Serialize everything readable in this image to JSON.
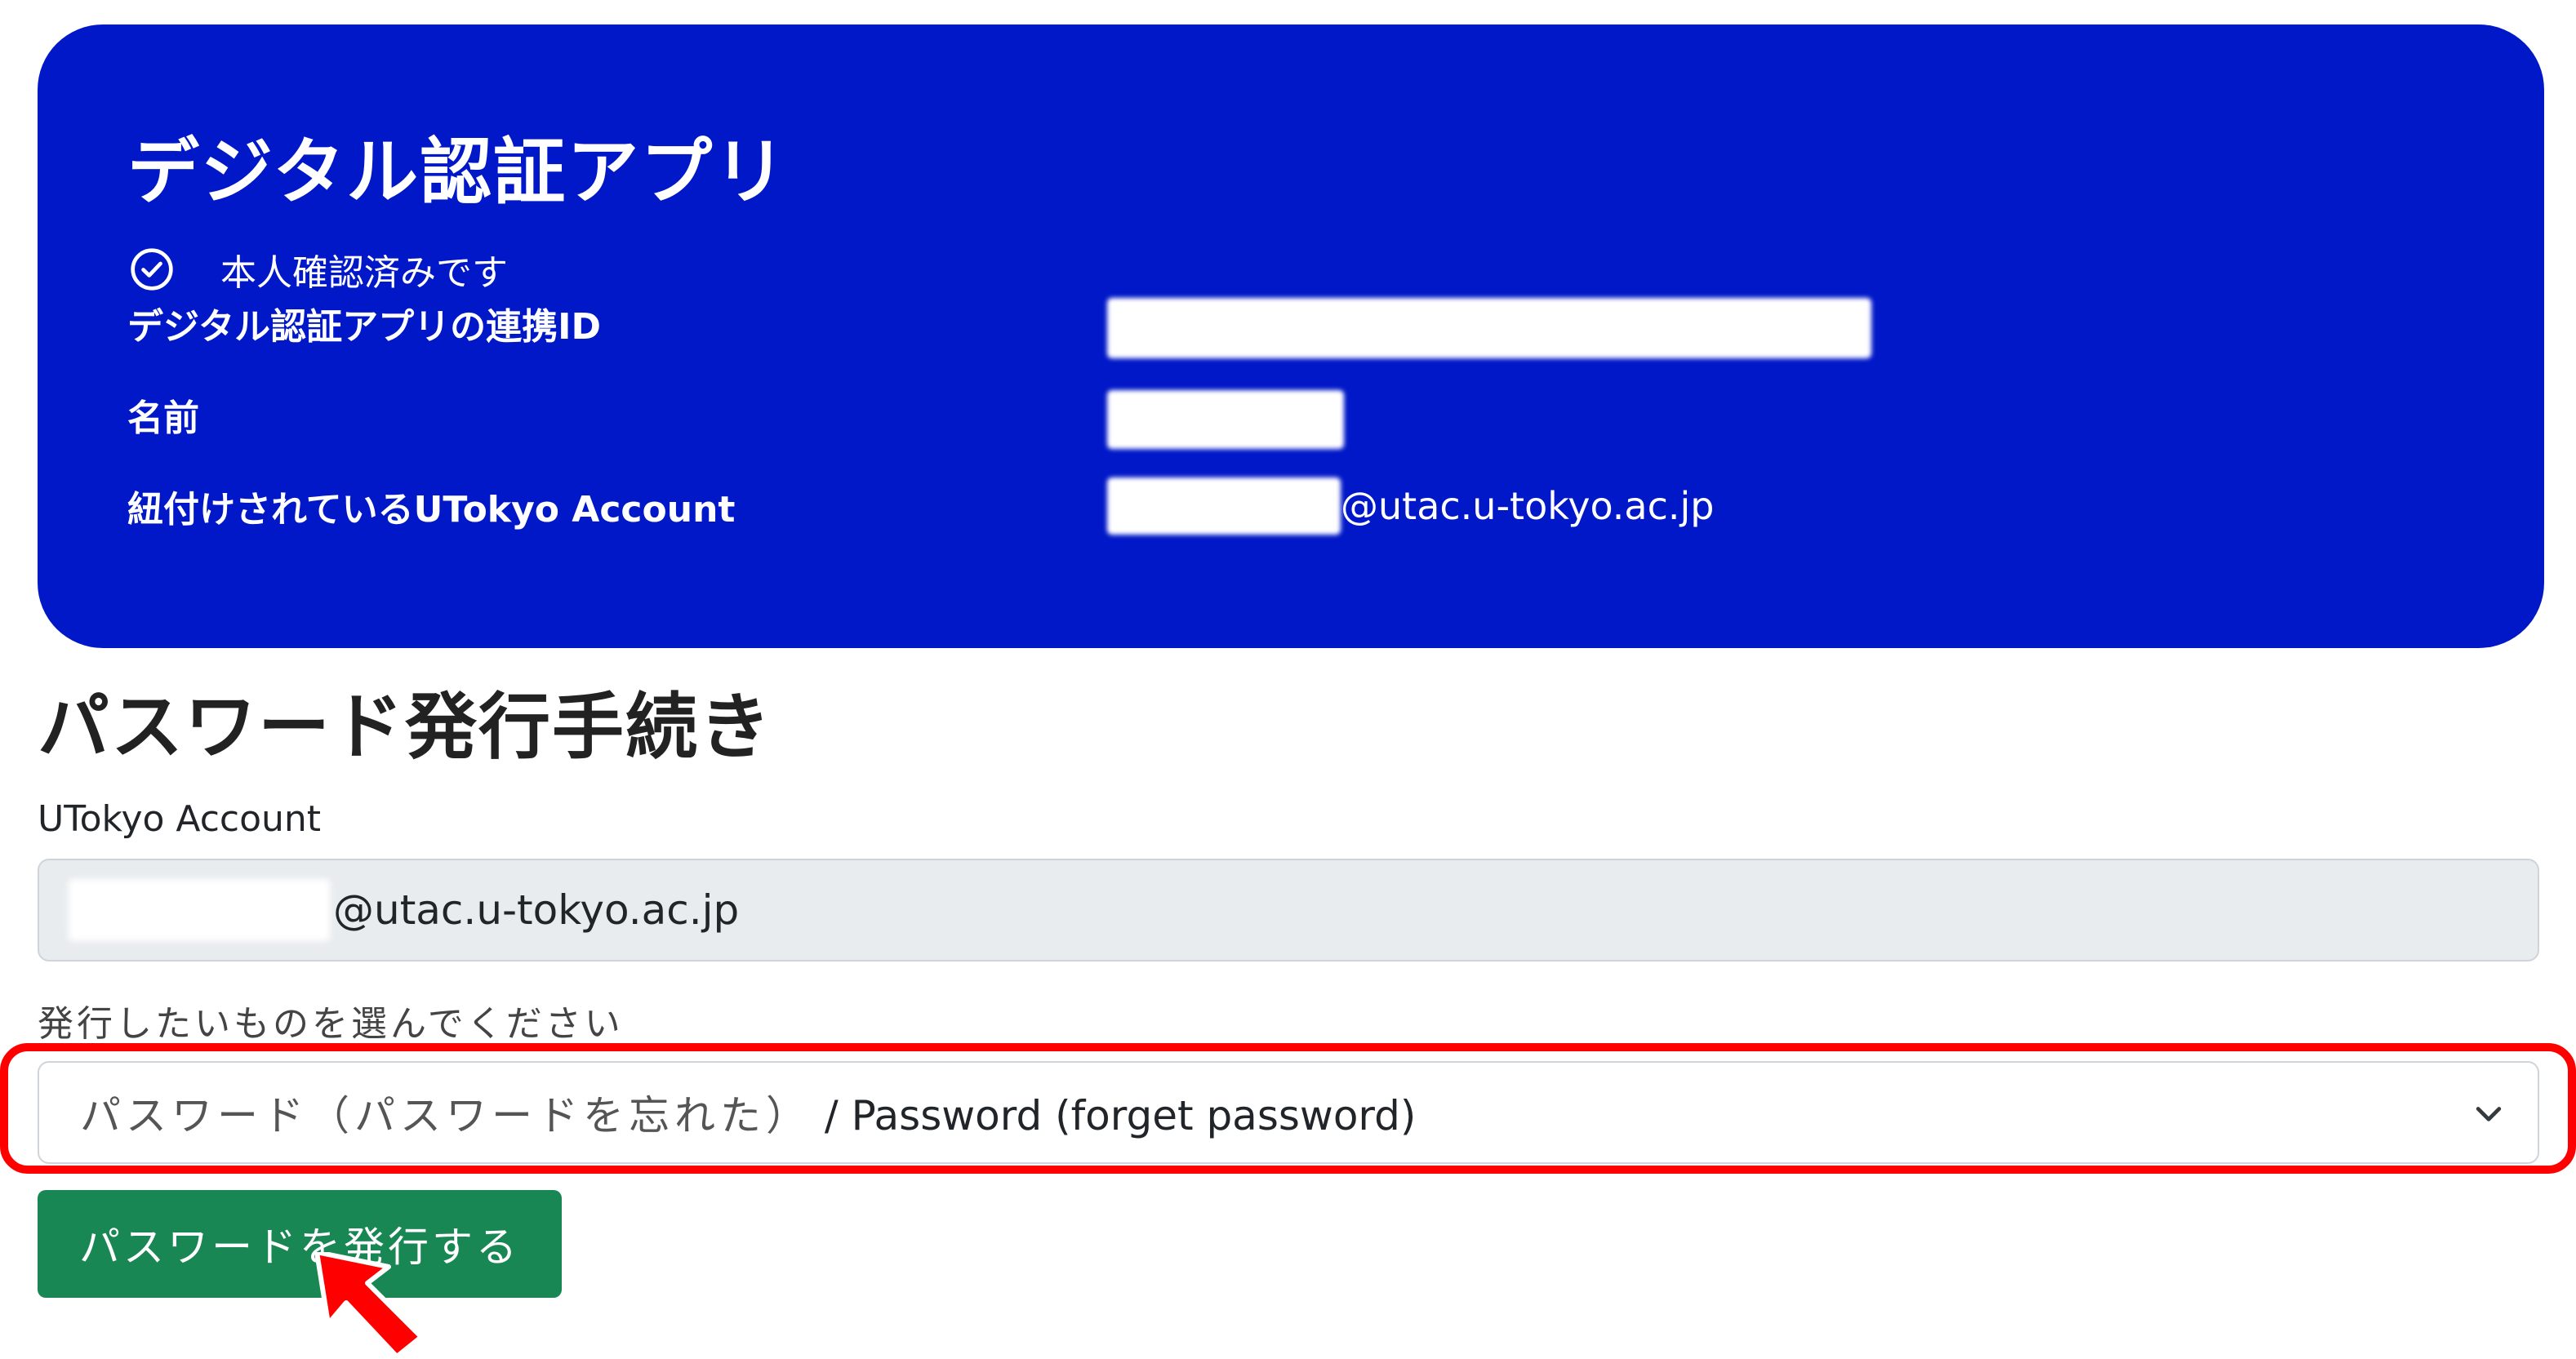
{
  "card": {
    "title": "デジタル認証アプリ",
    "verified_text": "本人確認済みです",
    "rows": [
      {
        "label": "デジタル認証アプリの連携ID",
        "value": ""
      },
      {
        "label": "名前",
        "value": ""
      },
      {
        "label": "紐付けされているUTokyo Account",
        "value_suffix": "@utac.u-tokyo.ac.jp"
      }
    ],
    "background_color": "#0018c8"
  },
  "form": {
    "title": "パスワード発行手続き",
    "account_label": "UTokyo Account",
    "account_value_suffix": "@utac.u-tokyo.ac.jp",
    "select_label": "発行したいものを選んでください",
    "select_value_jp": "パスワード（パスワードを忘れた）",
    "select_value_en": " / Password (forget password)",
    "submit_label": "パスワードを発行する",
    "submit_color": "#198754"
  },
  "annotations": {
    "highlight_color": "#ff0000",
    "arrow_icon": "arrow-pointer-icon"
  }
}
